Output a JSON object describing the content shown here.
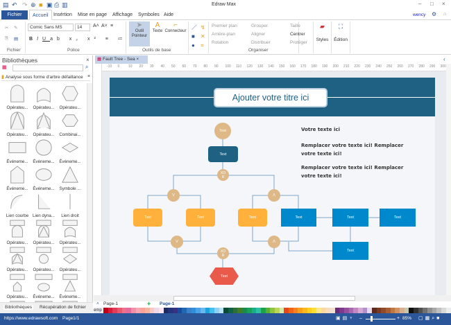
{
  "app": {
    "title": "Edraw Max",
    "user": "wency"
  },
  "menu": {
    "file": "Fichier",
    "tabs": [
      "Accueil",
      "Insértion",
      "Mise en page",
      "Affichage",
      "Symboles",
      "Aide"
    ]
  },
  "ribbon": {
    "font": "Comic Sans MS",
    "size": "14",
    "groups": {
      "file": "Fichier",
      "font": "Police",
      "tools": "Outils de base",
      "arrange": "Organiser"
    },
    "pointer": "Outil Pointeur",
    "text": "Texte",
    "connector": "Connecteur",
    "arrange_items": [
      "Premier plan",
      "Arrière-plan",
      "Rotation",
      "Grouper",
      "Aligner",
      "Distribuer",
      "Taille",
      "Centrer",
      "Protéger"
    ],
    "styles": "Styles",
    "edition": "Édition"
  },
  "library": {
    "title": "Bibliothèques",
    "search_placeholder": "",
    "category": "Analyse sous forme d'arbre défaillance",
    "items": [
      "Opérateu...",
      "Opérateu...",
      "Opérateu...",
      "Opérateu...",
      "Opérateu...",
      "Combinai...",
      "Événeme...",
      "Événeme...",
      "Événeme...",
      "Événeme...",
      "Événeme...",
      "Symbole ...",
      "Lien courbe",
      "Lien dyna...",
      "Lien droit",
      "Opérateu...",
      "Opérateu...",
      "Opérateu...",
      "Opérateu...",
      "Opérateu...",
      "Opérateu...",
      "Opérateu...",
      "Événeme...",
      "Événeme...",
      "",
      "",
      ""
    ],
    "tabs": [
      "Bibliothèques",
      "Récupération de fichier"
    ]
  },
  "document": {
    "tab": "Fault Tree - Sea",
    "ruler": [
      "-10",
      "0",
      "10",
      "20",
      "30",
      "40",
      "50",
      "60",
      "70",
      "80",
      "90",
      "100",
      "110",
      "120",
      "130",
      "140",
      "150",
      "160",
      "170",
      "180",
      "190",
      "200",
      "210",
      "220",
      "230",
      "240",
      "250",
      "260",
      "270",
      "280",
      "290",
      "300"
    ]
  },
  "page": {
    "title": "Ajouter votre titre ici",
    "text1": "Votre texte ici",
    "text2": "Remplacer votre texte ici!  Remplacer votre texte ici!",
    "text3": "Remplacer votre texte ici! Remplacer votre texte ici!",
    "node": "Text",
    "xor": "XO R",
    "or": "V",
    "and": "Λ"
  },
  "pages": {
    "current": "Page-1",
    "tab": "Page-1",
    "palette_label": "emp"
  },
  "status": {
    "url": "https://www.edrawsoft.com",
    "page": "Page1/1",
    "zoom": "85%"
  },
  "colors": {
    "accent": "#2b579a",
    "header": "#1f6183",
    "gate": "#deb887",
    "orange": "#ffb13b",
    "blue": "#0088cc",
    "red": "#ea5a4a",
    "palette": [
      "#c00018",
      "#d81b3a",
      "#e03c5a",
      "#e95670",
      "#f0708a",
      "#e36b9c",
      "#f08fa6",
      "#f6a8b5",
      "#f9a29a",
      "#f6b39d",
      "#f9c8c0",
      "#efd8e8",
      "#fce4ec",
      "#1c2a5e",
      "#25347a",
      "#3a2f80",
      "#1a4b9a",
      "#2166b5",
      "#3b80c8",
      "#2f8fd8",
      "#4aa3e6",
      "#67b8ee",
      "#1ea0dc",
      "#44c0f0",
      "#8fd0f5",
      "#b8e2f8",
      "#0c4a33",
      "#0f6448",
      "#2d6e3a",
      "#3e7d2a",
      "#1e8a4a",
      "#1ba05c",
      "#17ae8c",
      "#2bc2a4",
      "#1ca34a",
      "#5ab030",
      "#8cc63f",
      "#bcd65a",
      "#d8e8b0",
      "#e8461c",
      "#f06418",
      "#f58220",
      "#f8a01a",
      "#fbb81a",
      "#fdd020",
      "#fde030",
      "#fee88a",
      "#fbd8a0",
      "#f6dcc0",
      "#f0e0d0",
      "#6a2a7a",
      "#7e3a8e",
      "#94509e",
      "#a868b0",
      "#c286c0",
      "#d6a8d4",
      "#b090c8",
      "#e8d8f0",
      "#5a2a1a",
      "#7a3a22",
      "#924a2c",
      "#a85e34",
      "#c07840",
      "#d09060",
      "#d8b090",
      "#c8c8b0",
      "#101010",
      "#303030",
      "#505050",
      "#707070",
      "#909090",
      "#a8a8a8",
      "#c0c0c0",
      "#d8d8d8",
      "#ececec"
    ]
  }
}
